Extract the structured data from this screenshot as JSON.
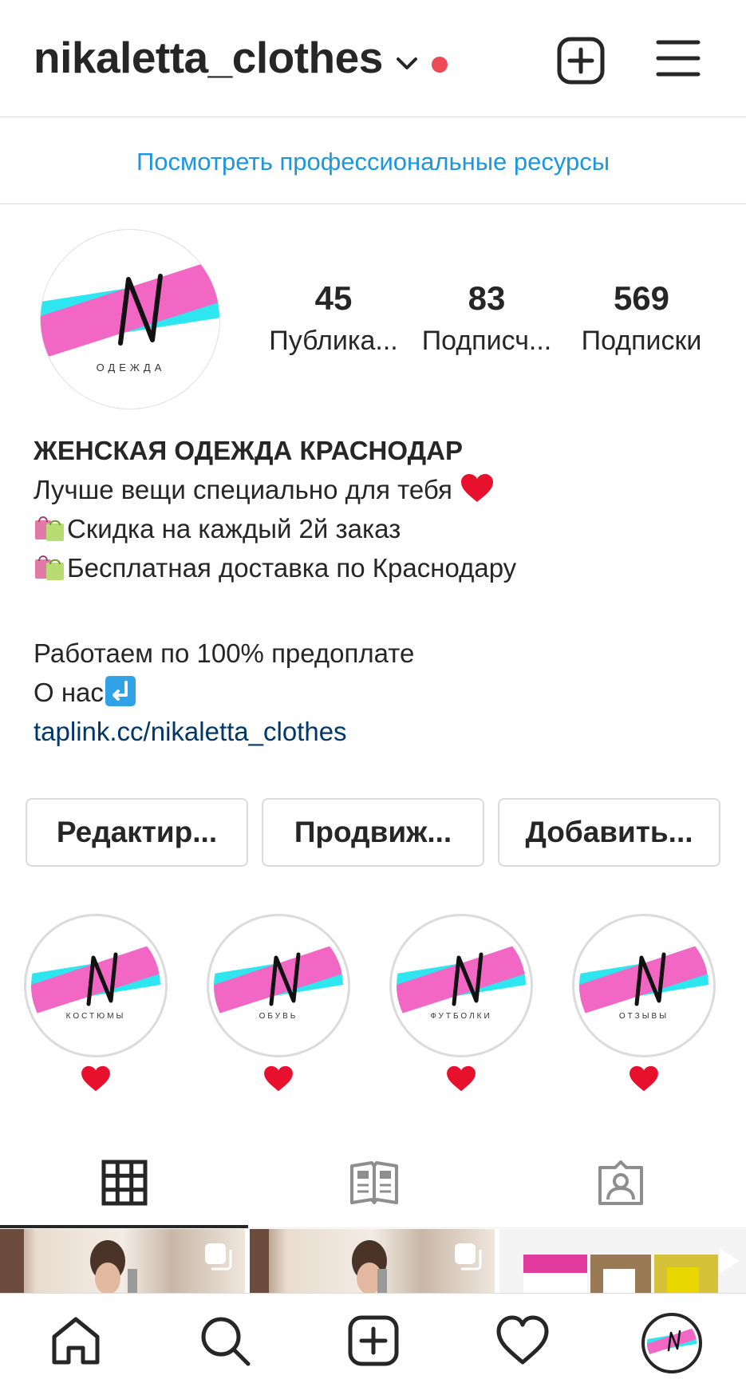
{
  "header": {
    "username": "nikaletta_clothes",
    "notification_color": "#ed4956",
    "new_post_icon": "plus-square-icon",
    "menu_icon": "hamburger-menu-icon"
  },
  "pro_banner": {
    "label": "Посмотреть профессиональные ресурсы",
    "color": "#1e96dc"
  },
  "profile": {
    "avatar_text": "ОДЕЖДА",
    "stats": [
      {
        "count": "45",
        "label": "Публика..."
      },
      {
        "count": "83",
        "label": "Подписч..."
      },
      {
        "count": "569",
        "label": "Подписки"
      }
    ],
    "bio": {
      "name": "ЖЕНСКАЯ ОДЕЖДА КРАСНОДАР",
      "line1": "Лучше вещи специально для тебя",
      "line2": "Скидка на каждый 2й заказ",
      "line3": "Бесплатная доставка по Краснодару",
      "line4": "Работаем по 100% предоплате",
      "line5": "О нас",
      "link": "taplink.cc/nikaletta_clothes"
    }
  },
  "actions": [
    {
      "label": "Редактир..."
    },
    {
      "label": "Продвиж..."
    },
    {
      "label": "Добавить..."
    }
  ],
  "highlights": [
    {
      "cover_text": "КОСТЮМЫ",
      "caption_icon": "red-heart-emoji"
    },
    {
      "cover_text": "ОБУВЬ",
      "caption_icon": "red-heart-emoji"
    },
    {
      "cover_text": "ФУТБОЛКИ",
      "caption_icon": "red-heart-emoji"
    },
    {
      "cover_text": "ОТЗЫВЫ",
      "caption_icon": "red-heart-emoji"
    }
  ],
  "tabs": [
    {
      "icon": "grid-icon",
      "active": true
    },
    {
      "icon": "guides-icon",
      "active": false
    },
    {
      "icon": "tagged-icon",
      "active": false
    }
  ],
  "bottom_nav": [
    "home-icon",
    "search-icon",
    "create-icon",
    "activity-heart-icon",
    "profile-avatar"
  ],
  "brand_colors": {
    "cyan": "#2ee6f0",
    "pink": "#f266c4"
  }
}
